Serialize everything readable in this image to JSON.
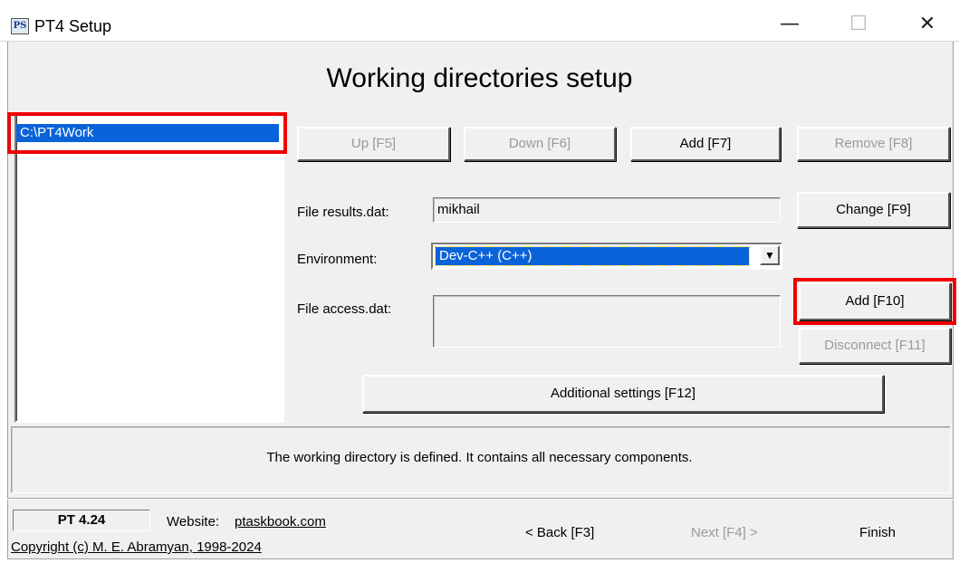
{
  "window": {
    "title": "PT4 Setup",
    "icon_label": "PS",
    "minimize_glyph": "—",
    "maximize_glyph": "☐",
    "close_glyph": "✕"
  },
  "header": {
    "title": "Working directories setup"
  },
  "directories": {
    "items": [
      {
        "label": "C:\\PT4Work",
        "selected": true
      }
    ]
  },
  "toolbar": {
    "up_label": "Up [F5]",
    "down_label": "Down [F6]",
    "add_label": "Add [F7]",
    "remove_label": "Remove [F8]"
  },
  "form": {
    "results_label": "File results.dat:",
    "results_value": "mikhail",
    "change_label": "Change [F9]",
    "environment_label": "Environment:",
    "environment_value": "Dev-C++ (C++)",
    "access_label": "File access.dat:",
    "access_value": "",
    "add_access_label": "Add [F10]",
    "disconnect_label": "Disconnect [F11]",
    "additional_label": "Additional settings [F12]"
  },
  "status": {
    "message": "The working directory is defined. It contains all necessary components."
  },
  "footer": {
    "version": "PT 4.24",
    "website_label": "Website:",
    "website_link": "ptaskbook.com",
    "copyright": "Copyright (c) M. E. Abramyan, 1998-2024",
    "back_label": "< Back [F3]",
    "next_label": "Next [F4] >",
    "finish_label": "Finish"
  },
  "colors": {
    "highlight": "#0a63d8",
    "annotation": "#f00000",
    "face": "#f0f0f0"
  }
}
